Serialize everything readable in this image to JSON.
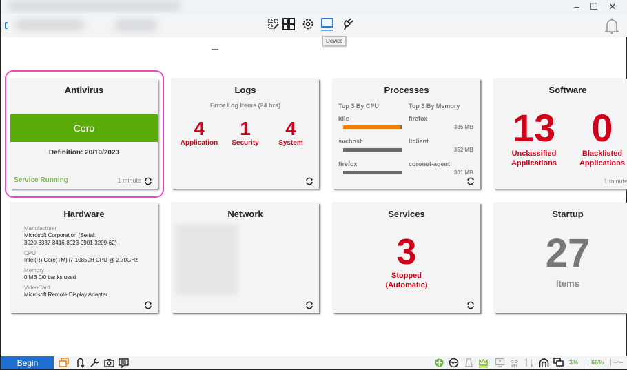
{
  "window": {
    "minimize": "–",
    "maximize": "☐",
    "close": "✕"
  },
  "header": {
    "nav_icons": [
      "edit-grid-icon",
      "dashboard-icon",
      "settings-icon",
      "device-icon",
      "plugin-icon"
    ],
    "active": "device-icon",
    "tooltip": "Device"
  },
  "cards": {
    "antivirus": {
      "title": "Antivirus",
      "product": "Coro",
      "definition": "Definition: 20/10/2023",
      "status": "Service Running",
      "updated": "1 minute",
      "colors": {
        "band": "#5aaa0a",
        "status": "#78b94a"
      }
    },
    "logs": {
      "title": "Logs",
      "subtitle": "Error Log Items (24 hrs)",
      "items": [
        {
          "count": "4",
          "label": "Application"
        },
        {
          "count": "1",
          "label": "Security"
        },
        {
          "count": "4",
          "label": "System"
        }
      ]
    },
    "processes": {
      "title": "Processes",
      "cpu_header": "Top 3 By CPU",
      "mem_header": "Top 3 By Memory",
      "cpu": [
        {
          "name": "idle",
          "usage_pct": 97
        },
        {
          "name": "svchost",
          "usage_pct": 0
        },
        {
          "name": "firefox",
          "usage_pct": 0
        }
      ],
      "memory": [
        {
          "name": "firefox",
          "value": "385 MB"
        },
        {
          "name": "ltclient",
          "value": "352 MB"
        },
        {
          "name": "coronet-agent",
          "value": "301 MB"
        }
      ]
    },
    "software": {
      "title": "Software",
      "items": [
        {
          "count": "13",
          "label1": "Unclassified",
          "label2": "Applications"
        },
        {
          "count": "0",
          "label1": "Blacklisted",
          "label2": "Applications"
        }
      ],
      "updated": "1 minute"
    },
    "hardware": {
      "title": "Hardware",
      "fields": [
        {
          "label": "Manufacturer",
          "value1": "Microsoft Corporation (Serial:",
          "value2": "3020-8337-8416-8023-9901-3209-62)"
        },
        {
          "label": "CPU",
          "value1": "Intel(R) Core(TM) i7-10850H CPU @ 2.70GHz",
          "value2": ""
        },
        {
          "label": "Memory",
          "value1": "0 MB 0/0 banks used",
          "value2": ""
        },
        {
          "label": "VideoCard",
          "value1": "Microsoft Remote Display Adapter",
          "value2": ""
        }
      ]
    },
    "network": {
      "title": "Network"
    },
    "services": {
      "title": "Services",
      "count": "3",
      "label1": "Stopped",
      "label2": "(Automatic)"
    },
    "startup": {
      "title": "Startup",
      "count": "27",
      "label": "Items"
    }
  },
  "taskbar": {
    "begin": "Begin",
    "cpu_pct": "3%",
    "mem_pct": "66%",
    "extra": "--:--"
  }
}
